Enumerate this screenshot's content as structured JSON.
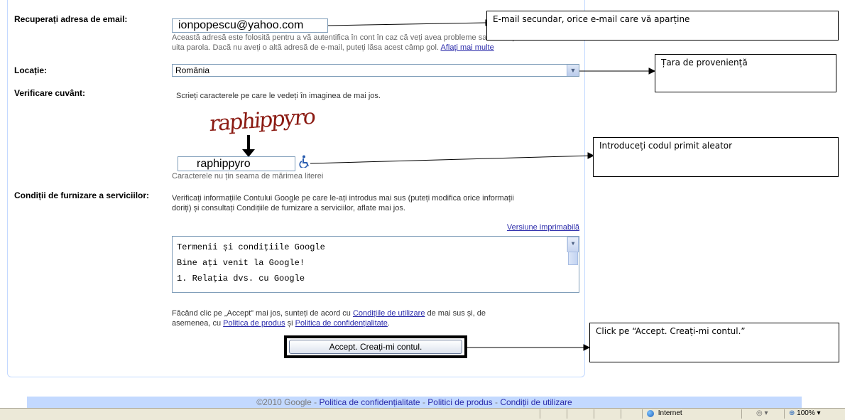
{
  "recovery_email": {
    "label": "Recuperați adresa de email:",
    "value": "ionpopescu@yahoo.com",
    "help_line1": "Această adresă este folosită pentru a vă autentifica în cont în caz că veți avea probleme sau vă veți",
    "help_line2": "uita parola. Dacă nu aveți o altă adresă de e-mail, puteți lăsa acest câmp gol.",
    "learn_more": "Aflați mai multe"
  },
  "location": {
    "label": "Locație:",
    "selected": "România"
  },
  "word_verification": {
    "label": "Verificare cuvânt:",
    "instruction": "Scrieți caracterele pe care le vedeți în imaginea de mai jos.",
    "captcha_text": "raphippyro",
    "input_value": "raphippyro",
    "case_note": "Caracterele nu țin seama de mărimea literei"
  },
  "terms": {
    "label": "Condiții de furnizare a serviciilor:",
    "intro_line1": "Verificați informațiile Contului Google pe care le-ați introdus mai sus (puteți modifica orice informații",
    "intro_line2": "doriți) și consultați Condițiile de furnizare a serviciilor, aflate mai jos.",
    "printable": "Versiune imprimabilă",
    "lines": [
      "Termenii și condițiile Google",
      "",
      "Bine ați venit la Google!",
      "",
      "1. Relația dvs. cu Google"
    ],
    "agree_prefix": "Făcând clic pe „Accept” mai jos, sunteți de acord cu ",
    "agree_link1": "Condițiile de utilizare",
    "agree_mid": " de mai sus și, de",
    "agree_prefix2": "asemenea, cu ",
    "agree_link2": "Politica de produs",
    "agree_and": " și ",
    "agree_link3": "Politica de confidențialitate",
    "agree_end": ".",
    "accept_button": "Accept. Creați-mi contul."
  },
  "callouts": {
    "email": "E-mail secundar, orice e-mail care vă aparține",
    "country": "Țara de proveniență",
    "code": "Introduceți codul primit aleator",
    "accept": "Click pe “Accept. Creați-mi contul.”"
  },
  "footer": {
    "copyright": "©2010 Google",
    "sep": " - ",
    "link1": "Politica de confidențialitate",
    "link2": "Politici de produs",
    "link3": "Condiții de utilizare"
  },
  "status_bar": {
    "zone": "Internet",
    "zoom": "100%"
  }
}
